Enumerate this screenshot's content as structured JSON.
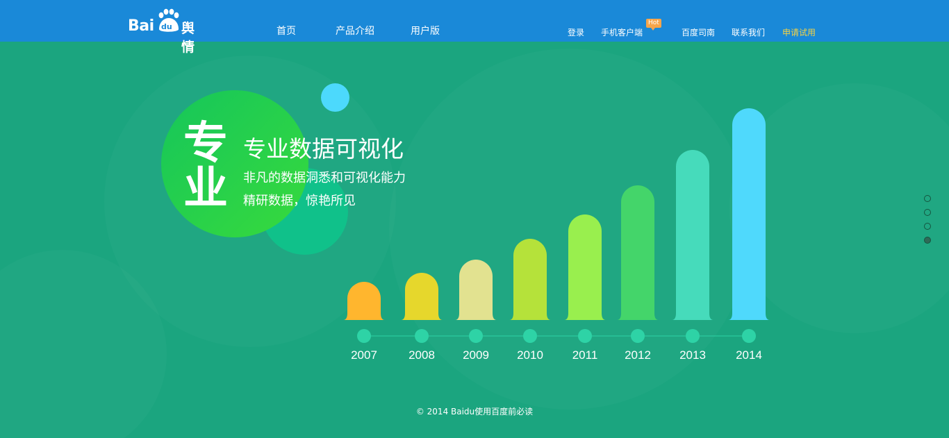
{
  "header": {
    "logo": {
      "text_bai": "Bai",
      "text_du": "du",
      "text_product": "舆情"
    },
    "nav_main": [
      {
        "label": "首页"
      },
      {
        "label": "产品介绍"
      },
      {
        "label": "用户版"
      }
    ],
    "nav_right": [
      {
        "label": "登录"
      },
      {
        "label": "手机客户端"
      },
      {
        "label": "百度司南"
      },
      {
        "label": "联系我们"
      },
      {
        "label": "申请试用"
      }
    ],
    "hot_badge": "Hot",
    "colors": {
      "bar": "#1a89d8",
      "highlight": "#f5d244",
      "hot": "#f5a54a"
    }
  },
  "hero": {
    "big_chars": [
      "专",
      "业"
    ],
    "headline": "专业数据可视化",
    "tagline_1": "非凡的数据洞悉和可视化能力",
    "tagline_2": "精研数据，惊艳所见"
  },
  "chart_data": {
    "type": "bar",
    "categories": [
      "2007",
      "2008",
      "2009",
      "2010",
      "2011",
      "2012",
      "2013",
      "2014"
    ],
    "values": [
      55,
      68,
      87,
      117,
      152,
      194,
      245,
      305
    ],
    "colors": [
      "#ffb62e",
      "#e6d72c",
      "#e2e290",
      "#b5e23a",
      "#99ef4e",
      "#44d56a",
      "#46dbbb",
      "#4fd9fc"
    ],
    "title": "",
    "xlabel": "",
    "ylabel": ""
  },
  "footer": {
    "copyright": "© 2014 Baidu使用百度前必读"
  },
  "page_nav": {
    "count": 4,
    "active_index": 3
  }
}
